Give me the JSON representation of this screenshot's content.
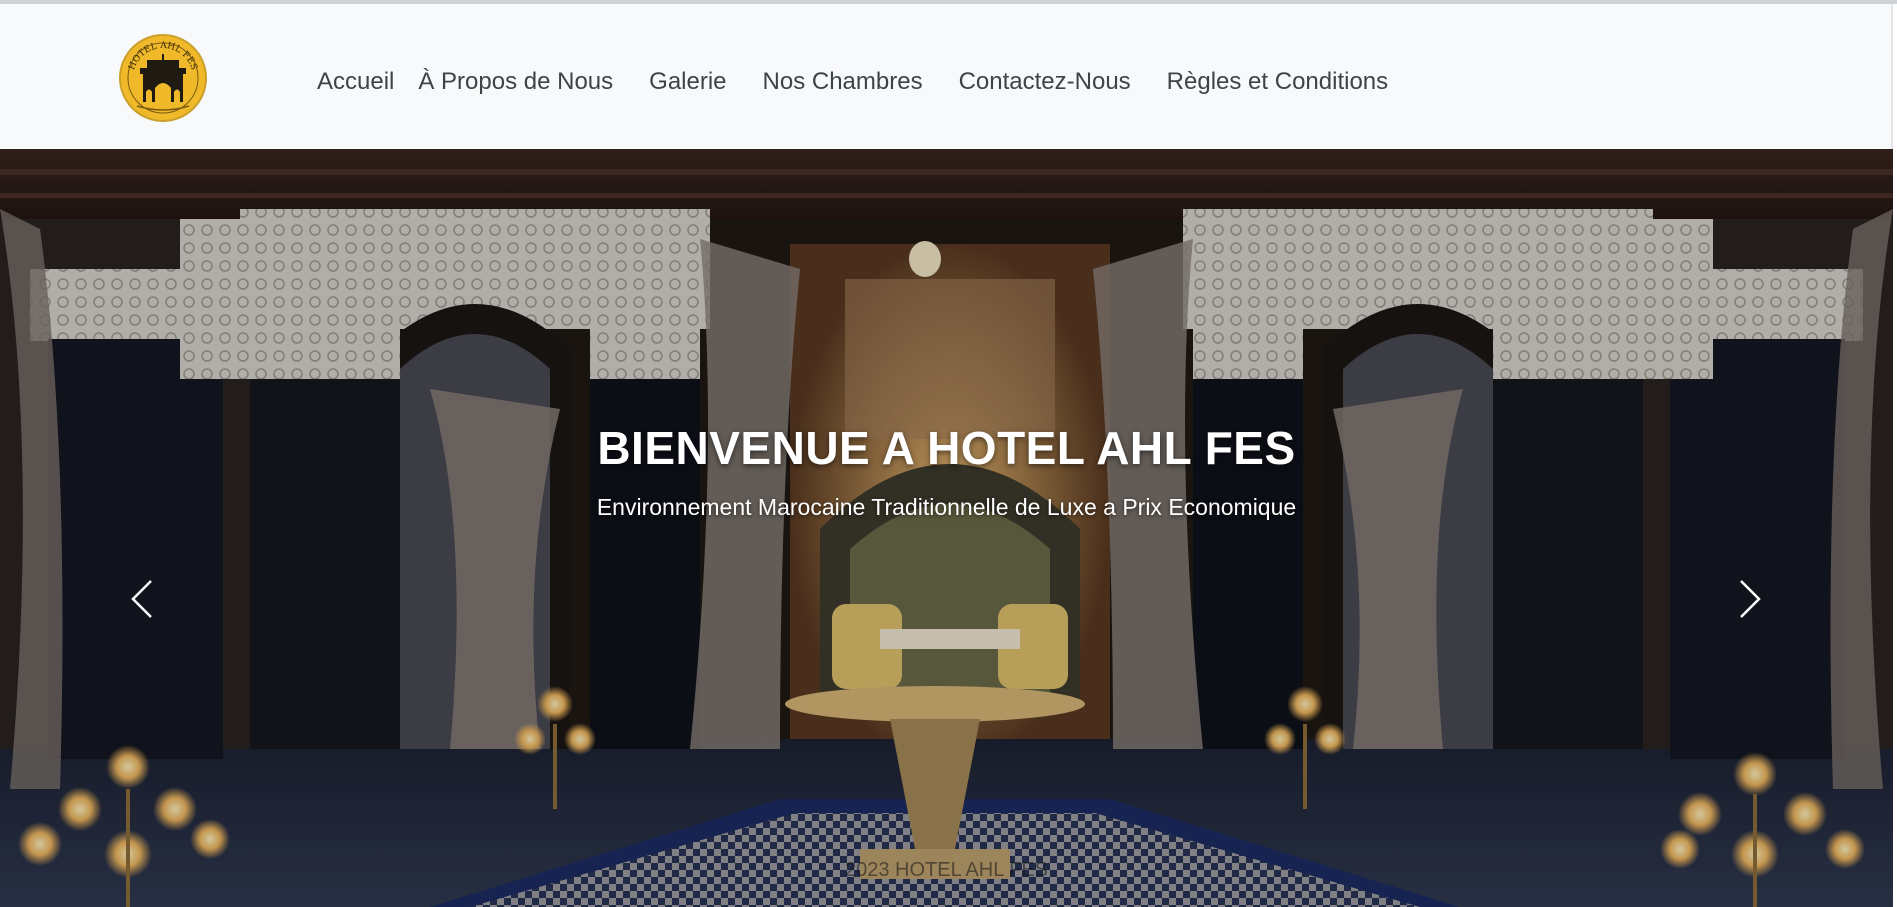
{
  "brand": {
    "logo_icon": "hotel-ahl-fes-logo",
    "logo_text": "HOTEL AHL FES",
    "logo_color": "#f0b92a"
  },
  "nav": {
    "items": [
      {
        "label": "Accueil"
      },
      {
        "label": "À Propos de Nous"
      },
      {
        "label": "Galerie"
      },
      {
        "label": "Nos Chambres"
      },
      {
        "label": "Contactez-Nous"
      },
      {
        "label": "Règles et Conditions"
      }
    ]
  },
  "hero": {
    "title": "BIENVENUE A HOTEL AHL FES",
    "subtitle": "Environnement Marocaine Traditionnelle de Luxe a Prix Economique",
    "prev_icon": "chevron-left-icon",
    "next_icon": "chevron-right-icon",
    "footer_text": "2023 HOTEL AHL FES"
  },
  "colors": {
    "navbar_bg": "#f8f9fa",
    "nav_text": "#3f4348",
    "hero_text": "#ffffff"
  }
}
